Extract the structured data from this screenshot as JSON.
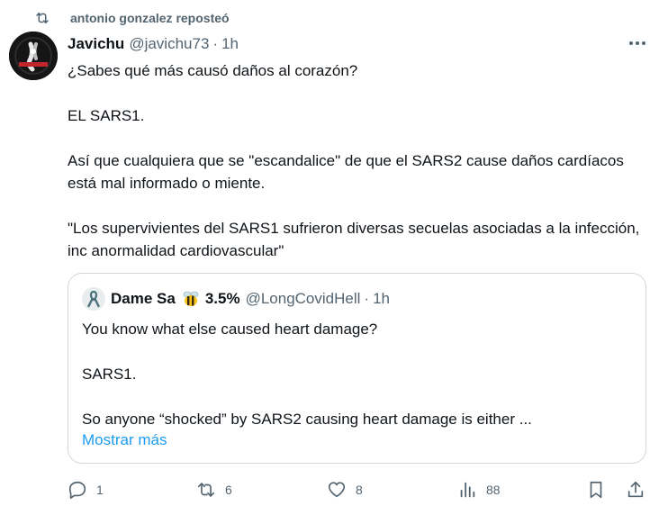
{
  "repost": {
    "icon": "repost-icon",
    "text": "antonio gonzalez reposteó"
  },
  "tweet": {
    "author_name": "Javichu",
    "handle": "@javichu73",
    "separator": "·",
    "time": "1h",
    "avatar_icon": "avatar-image",
    "lines": {
      "p1": "¿Sabes qué más causó daños al corazón?",
      "p2": "EL SARS1.",
      "p3": "Así que cualquiera que se \"escandalice\" de que el SARS2 cause daños cardíacos está mal informado o miente.",
      "p4": "\"Los supervivientes del SARS1 sufrieron diversas secuelas asociadas a la infección, inc anormalidad cardiovascular\""
    }
  },
  "quote": {
    "author_name": "Dame Sa",
    "emoji_icon": "bee-icon",
    "percent": "3.5%",
    "handle": "@LongCovidHell",
    "separator": "·",
    "time": "1h",
    "lines": {
      "p1": "You know what else caused heart damage?",
      "p2": "SARS1.",
      "p3": "So anyone “shocked” by SARS2 causing heart damage is either ..."
    },
    "show_more": "Mostrar más"
  },
  "actions": {
    "replies": "1",
    "reposts": "6",
    "likes": "8",
    "views": "88"
  },
  "colors": {
    "text": "#0f1419",
    "secondary": "#536471",
    "link": "#1d9bf0",
    "border": "#cfd9de"
  }
}
